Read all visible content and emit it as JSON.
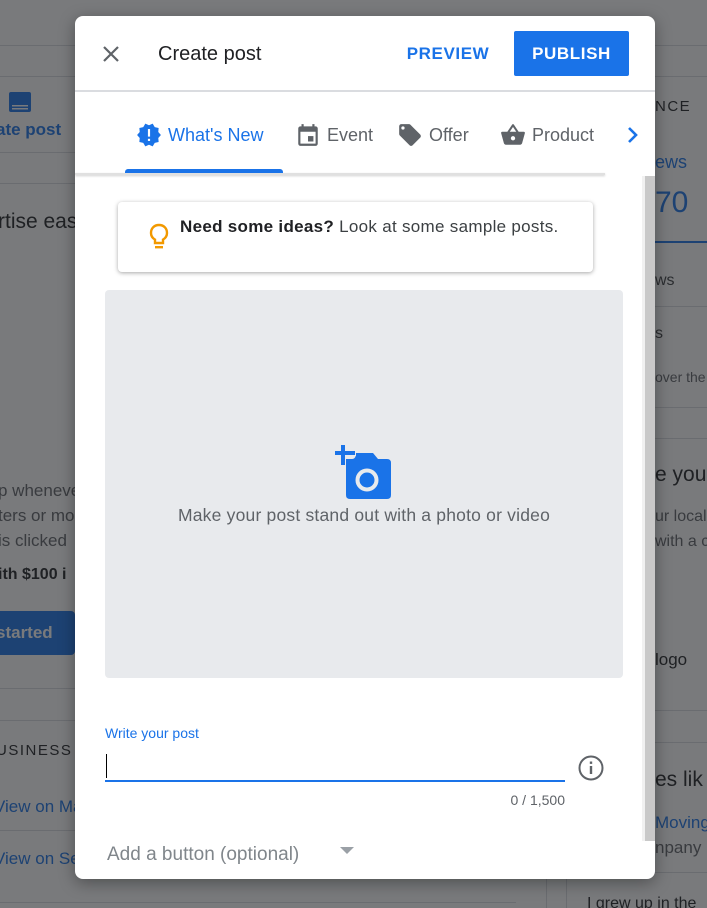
{
  "background": {
    "left_panel": {
      "create_post_label": "ate post",
      "advertise_heading": "rtise eas",
      "description_lines": [
        "p wheneve",
        "ters or mo",
        " is clicked"
      ],
      "bold_offer": "ith $100 i",
      "get_started_label": "started",
      "section_heading": "USINESS I",
      "links": [
        "View on Ma",
        "View on Se"
      ]
    },
    "right_panel": {
      "section_heading": "NCE",
      "views_label": "ews",
      "views_value": "70",
      "row1": "ws",
      "row2": "s",
      "row2_sub": "over the",
      "card_heading": "e you",
      "card_lines": [
        "ur local",
        "with a c"
      ],
      "logo_label": "logo",
      "people_heading": "es lik",
      "link_text": "Moving a",
      "company_text": "npany",
      "quote_text": "I grew up in the"
    }
  },
  "dialog": {
    "title": "Create post",
    "close_icon": "close-icon",
    "preview_label": "PREVIEW",
    "publish_label": "PUBLISH",
    "accent_color": "#1a73e8",
    "tabs": [
      {
        "label": "What's New",
        "icon": "new-releases-icon",
        "active": true
      },
      {
        "label": "Event",
        "icon": "calendar-icon",
        "active": false
      },
      {
        "label": "Offer",
        "icon": "tag-icon",
        "active": false
      },
      {
        "label": "Product",
        "icon": "basket-icon",
        "active": false
      }
    ],
    "next_tab_icon": "chevron-right-icon",
    "ideas": {
      "bold": "Need some ideas?",
      "text": " Look at some sample posts.",
      "icon": "lightbulb-icon",
      "icon_color": "#f29900"
    },
    "photo": {
      "icon": "add-photo-icon",
      "text": "Make your post stand out with a photo or video"
    },
    "post_field": {
      "label": "Write your post",
      "value": "",
      "counter": "0 / 1,500",
      "info_icon": "info-icon"
    },
    "add_button": {
      "placeholder": "Add a button (optional)"
    }
  }
}
